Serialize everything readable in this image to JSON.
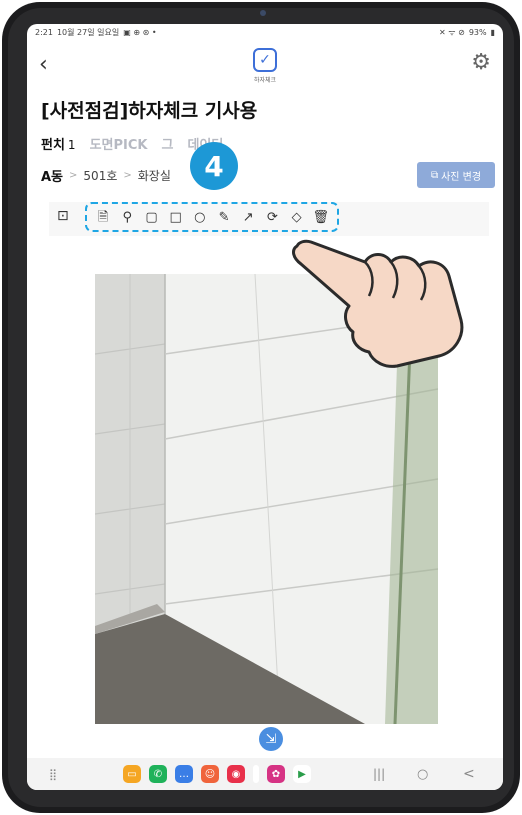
{
  "status_bar": {
    "time": "2:21",
    "date": "10월 27일 일요일",
    "battery": "93%"
  },
  "header": {
    "logo_label": "하자체크",
    "logo_glyph": "✓"
  },
  "page": {
    "title": "[사전점검]하자체크 기사용"
  },
  "tabs": [
    {
      "label": "펀치",
      "count": "1",
      "active": true
    },
    {
      "label": "도면PICK",
      "active": false
    },
    {
      "label": "그",
      "active": false
    },
    {
      "label": "데이터",
      "active": false
    }
  ],
  "breadcrumb": {
    "building": "A동",
    "unit": "501호",
    "room": "화장실",
    "separator": ">"
  },
  "photo_change_button": {
    "label": "사진 변경"
  },
  "step_badge": {
    "number": "4"
  },
  "toolbar": {
    "capture_icon": "camera-capture-icon",
    "tools": [
      {
        "name": "document-icon",
        "glyph": "🗎"
      },
      {
        "name": "location-pin-icon",
        "glyph": "⚲"
      },
      {
        "name": "rounded-rect-icon",
        "glyph": "▢"
      },
      {
        "name": "rectangle-icon",
        "glyph": "□"
      },
      {
        "name": "circle-icon",
        "glyph": "○"
      },
      {
        "name": "pen-icon",
        "glyph": "✎"
      },
      {
        "name": "arrow-icon",
        "glyph": "↗"
      },
      {
        "name": "rotate-icon",
        "glyph": "⟳"
      },
      {
        "name": "eraser-icon",
        "glyph": "◇"
      },
      {
        "name": "trash-icon",
        "glyph": "🗑"
      }
    ]
  },
  "nav": {
    "recent": "|||",
    "home": "○",
    "back": "<"
  },
  "colors": {
    "accent": "#1d98d6",
    "button": "#8eaad9",
    "logo": "#3d6fd8"
  }
}
